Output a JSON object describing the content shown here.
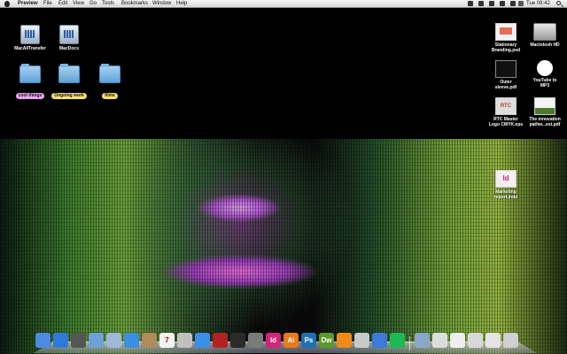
{
  "menubar": {
    "app_name": "Preview",
    "items": [
      "File",
      "Edit",
      "View",
      "Go",
      "Tools",
      "Bookmarks",
      "Window",
      "Help"
    ],
    "clock": "Tue 09:42"
  },
  "desktop": {
    "left_items": [
      {
        "label": "MacAllTransfer",
        "icon": "drive-icon"
      },
      {
        "label": "MacDocs",
        "icon": "drive-icon"
      }
    ],
    "folders": [
      {
        "tag": "cool things",
        "tag_color": "#e9a4f0"
      },
      {
        "tag": "Ongoing work",
        "tag_color": "#f4e26a"
      },
      {
        "tag": "films",
        "tag_color": "#f4e26a"
      }
    ],
    "right_items": [
      {
        "label": "Stationary\nBranding.psd",
        "icon": "psd-file-icon"
      },
      {
        "label": "Macintosh HD",
        "icon": "hard-drive-icon"
      },
      {
        "label": "Outer\nsleeve.pdf",
        "icon": "pdf-file-icon"
      },
      {
        "label": "YouTube to\nMP3",
        "icon": "app-icon"
      },
      {
        "label": "RTC Master\nLogo CMYK.eps",
        "icon": "eps-file-icon"
      },
      {
        "label": "The innovation\npathw...est.pdf",
        "icon": "pdf-file-icon"
      },
      {
        "label": "Marketing\nreport.indd",
        "icon": "indesign-file-icon"
      }
    ]
  },
  "dock": {
    "apps": [
      {
        "name": "finder-icon",
        "color": "#4a8ae0"
      },
      {
        "name": "app-store-icon",
        "color": "#2f7ad8"
      },
      {
        "name": "launchpad-icon",
        "color": "#555555"
      },
      {
        "name": "preview-icon",
        "color": "#6fa0d8"
      },
      {
        "name": "mail-icon",
        "color": "#9fb8d8"
      },
      {
        "name": "safari-icon",
        "color": "#3a8fe0"
      },
      {
        "name": "contacts-icon",
        "color": "#b08a5a"
      },
      {
        "name": "calendar-icon",
        "color": "#f2f2f2"
      },
      {
        "name": "photos-icon",
        "color": "#c0c0c0"
      },
      {
        "name": "itunes-icon",
        "color": "#3c8fe8"
      },
      {
        "name": "photo-booth-icon",
        "color": "#b22222"
      },
      {
        "name": "time-machine-icon",
        "color": "#2a2a2a"
      },
      {
        "name": "system-preferences-icon",
        "color": "#7a7a7a"
      },
      {
        "name": "indesign-icon",
        "color": "#d4237a"
      },
      {
        "name": "illustrator-icon",
        "color": "#e87a1a"
      },
      {
        "name": "photoshop-icon",
        "color": "#1f6fb5"
      },
      {
        "name": "dreamweaver-icon",
        "color": "#5a9a2a"
      },
      {
        "name": "vlc-icon",
        "color": "#f08a1a"
      },
      {
        "name": "automator-icon",
        "color": "#c8c8c8"
      },
      {
        "name": "virtualbox-icon",
        "color": "#3a7ad8"
      },
      {
        "name": "spotify-icon",
        "color": "#1db954"
      },
      {
        "name": "downloads-folder-icon",
        "color": "#8aa6c8"
      },
      {
        "name": "document-stack-icon",
        "color": "#dddddd"
      },
      {
        "name": "document-stack-icon",
        "color": "#eeeeee"
      },
      {
        "name": "document-stack-icon",
        "color": "#d8d8d8"
      },
      {
        "name": "document-stack-icon",
        "color": "#e4e4e4"
      },
      {
        "name": "trash-icon",
        "color": "#cfcfcf"
      }
    ],
    "glyphs": {
      "indesign": "Id",
      "illustrator": "Ai",
      "photoshop": "Ps",
      "dreamweaver": "Dw",
      "calendar": "7"
    }
  },
  "thumb_text": {
    "rtc": "RTC",
    "indd": "Id"
  }
}
